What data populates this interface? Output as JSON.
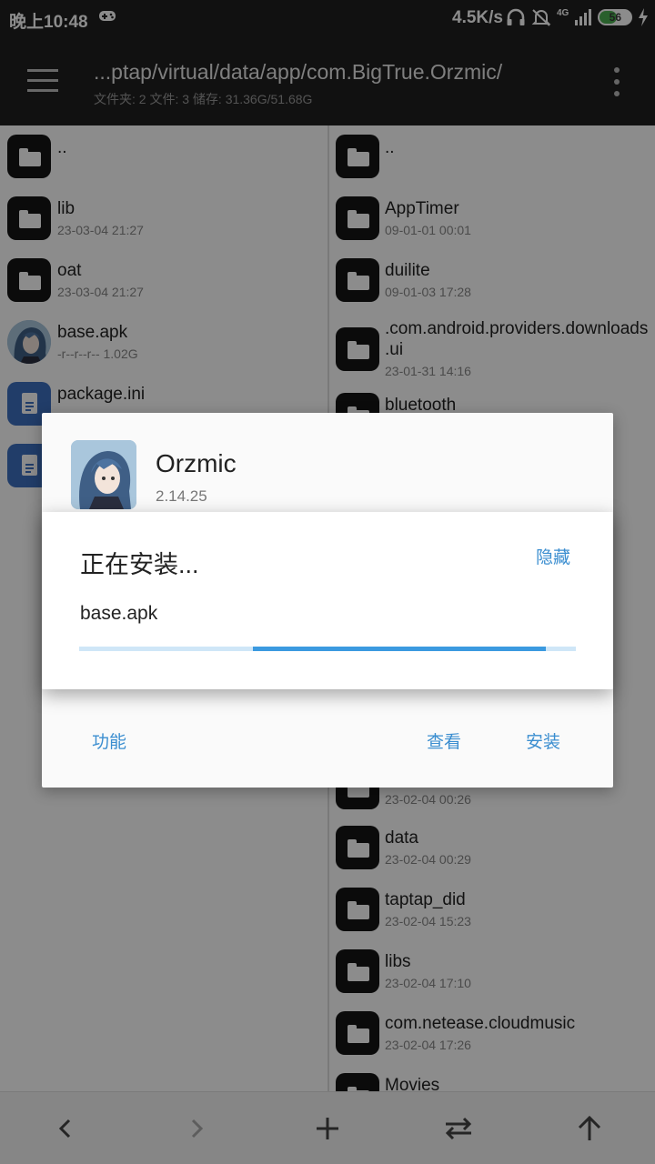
{
  "status_bar": {
    "time": "晚上10:48",
    "net_speed": "4.5K/s",
    "signal_label": "4G",
    "battery": "56",
    "battery_level": 0.56
  },
  "toolbar": {
    "path": "...ptap/virtual/data/app/com.BigTrue.Orzmic/",
    "summary": "文件夹: 2  文件: 3  储存: 31.36G/51.68G"
  },
  "left_pane": {
    "items": [
      {
        "name": "..",
        "meta": "",
        "type": "folder"
      },
      {
        "name": "lib",
        "meta": "23-03-04 21:27",
        "type": "folder"
      },
      {
        "name": "oat",
        "meta": "23-03-04 21:27",
        "type": "folder"
      },
      {
        "name": "base.apk",
        "meta": "-r--r--r--  1.02G",
        "type": "apk"
      },
      {
        "name": "package.ini",
        "meta": "",
        "type": "file"
      },
      {
        "name": "",
        "meta": "",
        "type": "file"
      }
    ]
  },
  "right_pane": {
    "items": [
      {
        "name": "..",
        "meta": ""
      },
      {
        "name": "AppTimer",
        "meta": "09-01-01 00:01"
      },
      {
        "name": "duilite",
        "meta": "09-01-03 17:28"
      },
      {
        "name": ".com.android.providers.downloads",
        "name2": ".ui",
        "meta": "23-01-31 14:16"
      },
      {
        "name": "bluetooth",
        "meta": ""
      },
      {
        "name": "",
        "meta": "23-02-04 00:26"
      },
      {
        "name": "data",
        "meta": "23-02-04 00:29"
      },
      {
        "name": "taptap_did",
        "meta": "23-02-04 15:23"
      },
      {
        "name": "libs",
        "meta": "23-02-04 17:10"
      },
      {
        "name": "com.netease.cloudmusic",
        "meta": "23-02-04 17:26"
      },
      {
        "name": "Movies",
        "meta": ""
      }
    ]
  },
  "app_dialog": {
    "app_name": "Orzmic",
    "version": "2.14.25",
    "btn_function": "功能",
    "btn_view": "查看",
    "btn_install": "安装"
  },
  "progress_dialog": {
    "title": "正在安装...",
    "hide": "隐藏",
    "file": "base.apk",
    "progress_start": 0.35,
    "progress_end": 0.94
  },
  "colors": {
    "accent": "#3b8ed0",
    "toolbar": "#1f1f1f",
    "progress": "#3b9ae0",
    "progress_track": "#cfe6f7",
    "battery": "#4caf50"
  }
}
